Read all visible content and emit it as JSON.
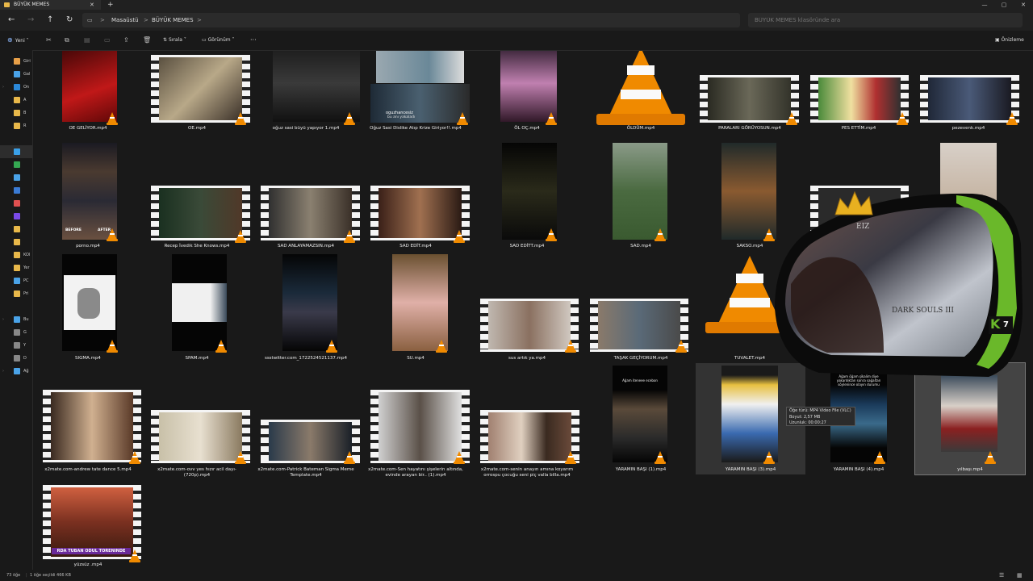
{
  "window": {
    "tab_title": "BÜYÜK MEMES",
    "tab_close": "✕",
    "new_tab": "+",
    "controls": [
      "—",
      "▢",
      "✕"
    ]
  },
  "address": {
    "back": "←",
    "forward": "→",
    "up": "↑",
    "refresh": "↻",
    "breadcrumbs": [
      "Masaüstü",
      "BÜYÜK MEMES"
    ],
    "separator": ">",
    "search_placeholder": "BÜYÜK MEMES klasöründe ara"
  },
  "command_bar": {
    "new_label": "Yeni",
    "sort_label": "Sırala",
    "view_label": "Görünüm",
    "more": "···",
    "preview_label": "Önizleme"
  },
  "sidebar": {
    "items": [
      {
        "label": "Giri",
        "color": "#e8a048"
      },
      {
        "label": "Gal",
        "color": "#4aa3e8"
      },
      {
        "label": "On",
        "color": "#2b88d8"
      },
      {
        "label": "A",
        "color": "#e8b84a"
      },
      {
        "label": "B",
        "color": "#e8b84a"
      },
      {
        "label": "R",
        "color": "#e8b84a"
      },
      {
        "label": "",
        "color": "#3aa0e8"
      },
      {
        "label": "",
        "color": "#35a852"
      },
      {
        "label": "",
        "color": "#4aa3e8"
      },
      {
        "label": "",
        "color": "#3a7bd5"
      },
      {
        "label": "",
        "color": "#e05050"
      },
      {
        "label": "",
        "color": "#7a4ae8"
      },
      {
        "label": "",
        "color": "#e8b84a"
      },
      {
        "label": "",
        "color": "#e8b84a"
      },
      {
        "label": "KOI",
        "color": "#e8b84a"
      },
      {
        "label": "Yer",
        "color": "#e8b84a"
      },
      {
        "label": "PC",
        "color": "#4aa3e8"
      },
      {
        "label": "Pri",
        "color": "#e8b84a"
      },
      {
        "label": "Bu",
        "color": "#4aa3e8"
      },
      {
        "label": "G",
        "color": "#888888"
      },
      {
        "label": "Y",
        "color": "#888888"
      },
      {
        "label": "D",
        "color": "#888888"
      },
      {
        "label": "Ağ",
        "color": "#4aa3e8"
      }
    ]
  },
  "files": [
    "OE GELİYOR.mp4",
    "OE.mp4",
    "oğuz sasi büyü yapıyor 1.mp4",
    "Oğuz Sasi Dislike Atıp Krize Giriyor!!.mp4",
    "ÖL OÇ.mp4",
    "ÖLDÜM.mp4",
    "PARALARI GÖRÜYOSUN.mp4",
    "PES ETTİM.mp4",
    "pezevenk.mp4",
    "porno.mp4",
    "Recep İvedik She Knows.mp4",
    "SAD ANLAYAMAZSIN.mp4",
    "SAD EDİT.mp4",
    "SAD EDİTT.mp4",
    "SAD.mp4",
    "SAKSO.mp4",
    "SIGMA.mp4",
    "SPAM.mp4",
    "ssstwitter.com_1722524521137.mp4",
    "SU.mp4",
    "sus artık ya.mp4",
    "TAŞAK GEÇİYORUM.mp4",
    "TUVALET.mp4",
    "x2mate.com-andrew tate dance 5.mp4",
    "x2mate.com-ovv yes hızır acil dayı-(720p).mp4",
    "x2mate.com-Patrick Bateman Sigma Meme Template.mp4",
    "x2mate.com-Sen hayatını şişelerin altında, evinde arayan bir.. (1).mp4",
    "x2mate.com-senin anayın amına koyarım orrospu çocuğu seni piç valla billa.mp4",
    "YARAMIN BAŞI (1).mp4",
    "YARAMIN BAŞI (3).mp4",
    "YARAMIN BAŞI (4).mp4",
    "yılbaşı.mp4",
    "yüzsüz .mp4"
  ],
  "thumb_texts": {
    "porno_before": "BEFORE",
    "porno_after": "AFTER",
    "oguz_caption": "oguzhancesiz",
    "oguz_sub": "bu anı yakaladı",
    "yarami1_caption": "Ağam iteneee ecebon",
    "yarami4_caption": "Ağam öğam şikalim diye yakardıktan sonra sağaltan söylenince olayın durumu",
    "yuzsuz_caption": "RDA TUBAN ODUL TORENINDE"
  },
  "tooltip": {
    "type": "Öğe türü: MP4 Video File (VLC)",
    "size": "Boyut: 2,57 MB",
    "length": "Uzunluk: 00:00:27"
  },
  "overlay": {
    "chair_brand": "DARK SOULS III",
    "chair_top": "EIZ",
    "logo_letter": "K",
    "logo_number": "7"
  },
  "status": {
    "count": "73 öğe",
    "selection": "1 öğe seçildi  466 KB"
  }
}
